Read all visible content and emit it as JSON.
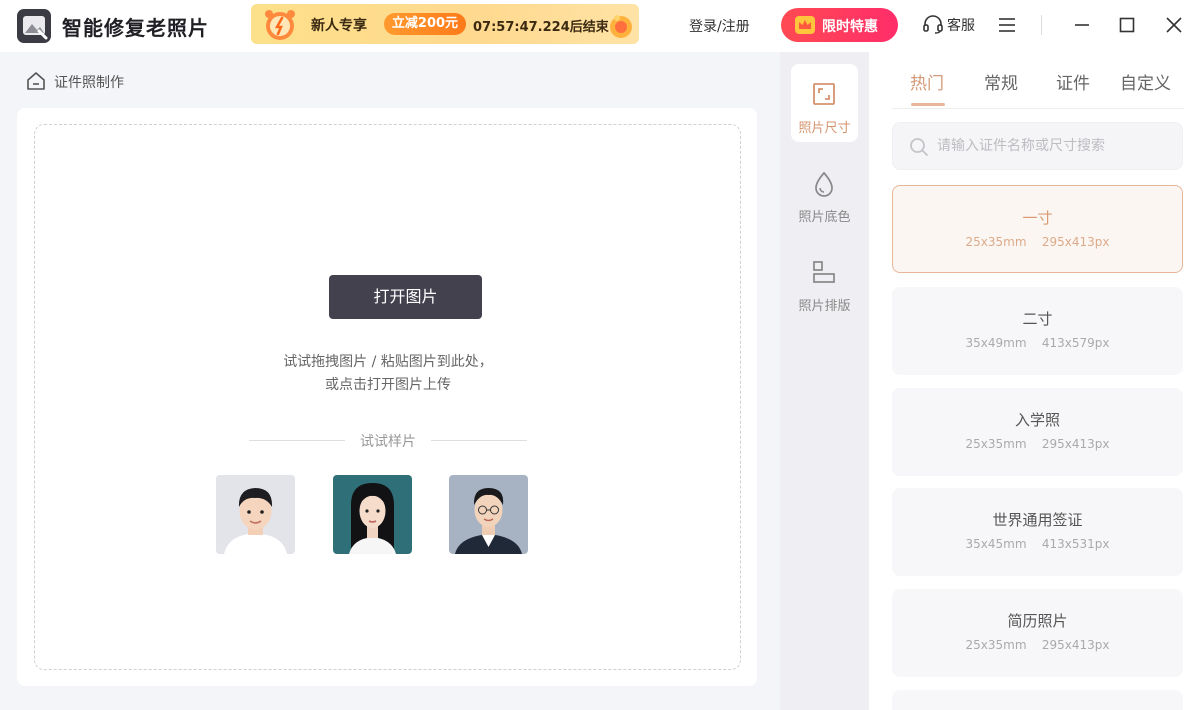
{
  "app": {
    "title": "智能修复老照片"
  },
  "promo": {
    "text": "新人专享",
    "badge": "立减200元",
    "countdown": "07:57:47.224后结束"
  },
  "header": {
    "login": "登录/注册",
    "vip": "限时特惠",
    "service": "客服"
  },
  "breadcrumb": {
    "label": "证件照制作"
  },
  "upload": {
    "open_button": "打开图片",
    "hint_line1": "试试拖拽图片 / 粘贴图片到此处，",
    "hint_line2": "或点击打开图片上传",
    "samples_label": "试试样片"
  },
  "tools": [
    {
      "label": "照片尺寸",
      "icon": "resize-icon",
      "active": true
    },
    {
      "label": "照片底色",
      "icon": "droplet-icon",
      "active": false
    },
    {
      "label": "照片排版",
      "icon": "layout-icon",
      "active": false
    }
  ],
  "tabs": [
    {
      "label": "热门",
      "active": true
    },
    {
      "label": "常规",
      "active": false
    },
    {
      "label": "证件",
      "active": false
    },
    {
      "label": "自定义",
      "active": false
    }
  ],
  "search": {
    "placeholder": "请输入证件名称或尺寸搜索"
  },
  "sizes": [
    {
      "name": "一寸",
      "mm": "25x35mm",
      "px": "295x413px",
      "selected": true
    },
    {
      "name": "二寸",
      "mm": "35x49mm",
      "px": "413x579px",
      "selected": false
    },
    {
      "name": "入学照",
      "mm": "25x35mm",
      "px": "295x413px",
      "selected": false
    },
    {
      "name": "世界通用签证",
      "mm": "35x45mm",
      "px": "413x531px",
      "selected": false
    },
    {
      "name": "简历照片",
      "mm": "25x35mm",
      "px": "295x413px",
      "selected": false
    }
  ],
  "colors": {
    "accent": "#d49a78",
    "vip_red": "#ff3a5c",
    "button_dark": "#44414f"
  }
}
